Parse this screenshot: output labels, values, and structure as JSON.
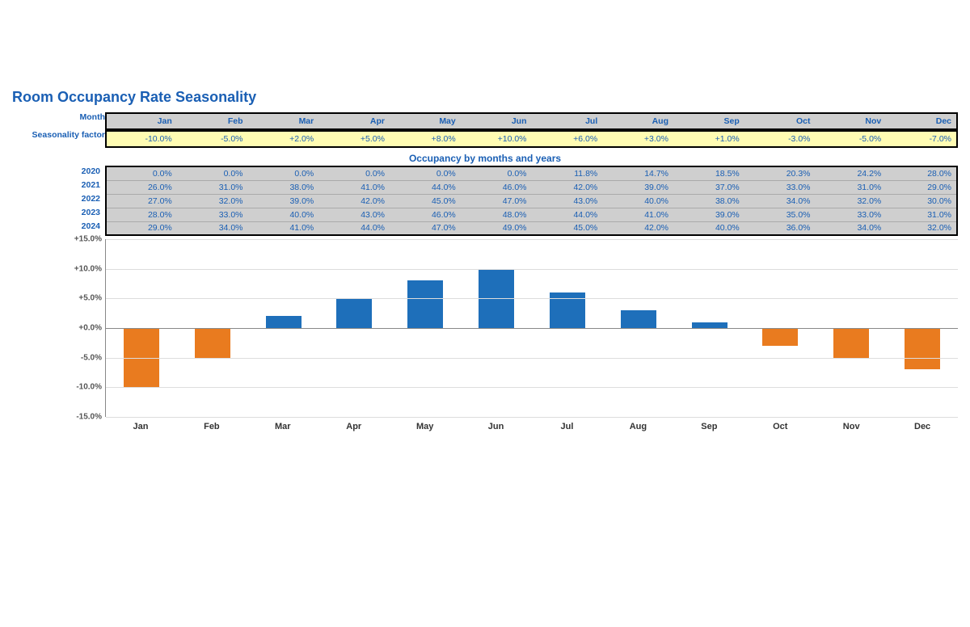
{
  "title": "Room Occupancy Rate Seasonality",
  "labels": {
    "month": "Month",
    "seasonality": "Seasonality factor",
    "occ_title": "Occupancy by months and years"
  },
  "months": [
    "Jan",
    "Feb",
    "Mar",
    "Apr",
    "May",
    "Jun",
    "Jul",
    "Aug",
    "Sep",
    "Oct",
    "Nov",
    "Dec"
  ],
  "seasonality": [
    "-10.0%",
    "-5.0%",
    "+2.0%",
    "+5.0%",
    "+8.0%",
    "+10.0%",
    "+6.0%",
    "+3.0%",
    "+1.0%",
    "-3.0%",
    "-5.0%",
    "-7.0%"
  ],
  "years": [
    "2020",
    "2021",
    "2022",
    "2023",
    "2024"
  ],
  "occupancy": [
    [
      "0.0%",
      "0.0%",
      "0.0%",
      "0.0%",
      "0.0%",
      "0.0%",
      "11.8%",
      "14.7%",
      "18.5%",
      "20.3%",
      "24.2%",
      "28.0%"
    ],
    [
      "26.0%",
      "31.0%",
      "38.0%",
      "41.0%",
      "44.0%",
      "46.0%",
      "42.0%",
      "39.0%",
      "37.0%",
      "33.0%",
      "31.0%",
      "29.0%"
    ],
    [
      "27.0%",
      "32.0%",
      "39.0%",
      "42.0%",
      "45.0%",
      "47.0%",
      "43.0%",
      "40.0%",
      "38.0%",
      "34.0%",
      "32.0%",
      "30.0%"
    ],
    [
      "28.0%",
      "33.0%",
      "40.0%",
      "43.0%",
      "46.0%",
      "48.0%",
      "44.0%",
      "41.0%",
      "39.0%",
      "35.0%",
      "33.0%",
      "31.0%"
    ],
    [
      "29.0%",
      "34.0%",
      "41.0%",
      "44.0%",
      "47.0%",
      "49.0%",
      "45.0%",
      "42.0%",
      "40.0%",
      "36.0%",
      "34.0%",
      "32.0%"
    ]
  ],
  "chart_data": {
    "type": "bar",
    "title": "",
    "xlabel": "",
    "ylabel": "",
    "categories": [
      "Jan",
      "Feb",
      "Mar",
      "Apr",
      "May",
      "Jun",
      "Jul",
      "Aug",
      "Sep",
      "Oct",
      "Nov",
      "Dec"
    ],
    "values": [
      -10.0,
      -5.0,
      2.0,
      5.0,
      8.0,
      10.0,
      6.0,
      3.0,
      1.0,
      -3.0,
      -5.0,
      -7.0
    ],
    "ylim": [
      -15.0,
      15.0
    ],
    "yticks": [
      15.0,
      10.0,
      5.0,
      0.0,
      -5.0,
      -10.0,
      -15.0
    ],
    "ytick_labels": [
      "+15.0%",
      "+10.0%",
      "+5.0%",
      "+0.0%",
      "-5.0%",
      "-10.0%",
      "-15.0%"
    ],
    "colors": {
      "positive": "#1e6fba",
      "negative": "#e97b1f"
    }
  }
}
